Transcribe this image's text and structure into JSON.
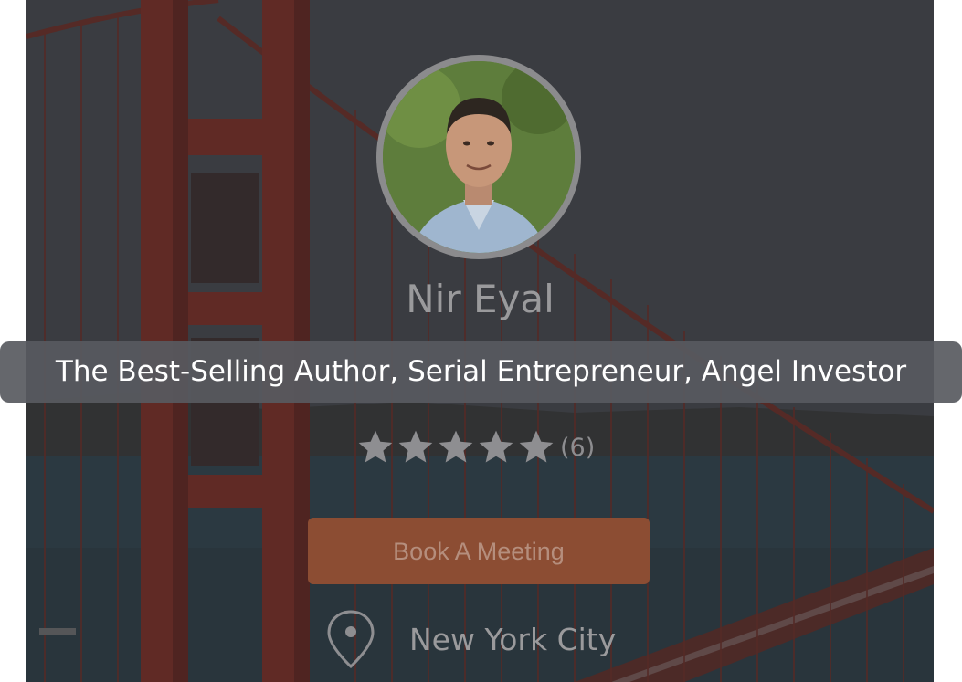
{
  "profile": {
    "name": "Nir Eyal",
    "tagline": "The Best-Selling Author, Serial Entrepreneur, Angel Investor",
    "rating": {
      "stars": 5,
      "max_stars": 5,
      "count_label": "(6)"
    },
    "cta_label": "Book A Meeting",
    "location": "New York City",
    "icons": {
      "location": "map-pin-icon",
      "star": "star-icon"
    }
  },
  "colors": {
    "cta_background": "#8c4d33",
    "cta_text": "#b58e7d",
    "tooltip_background": "#585a60",
    "bridge_red": "#8e2a1e",
    "text_muted": "#9a9a9c"
  }
}
